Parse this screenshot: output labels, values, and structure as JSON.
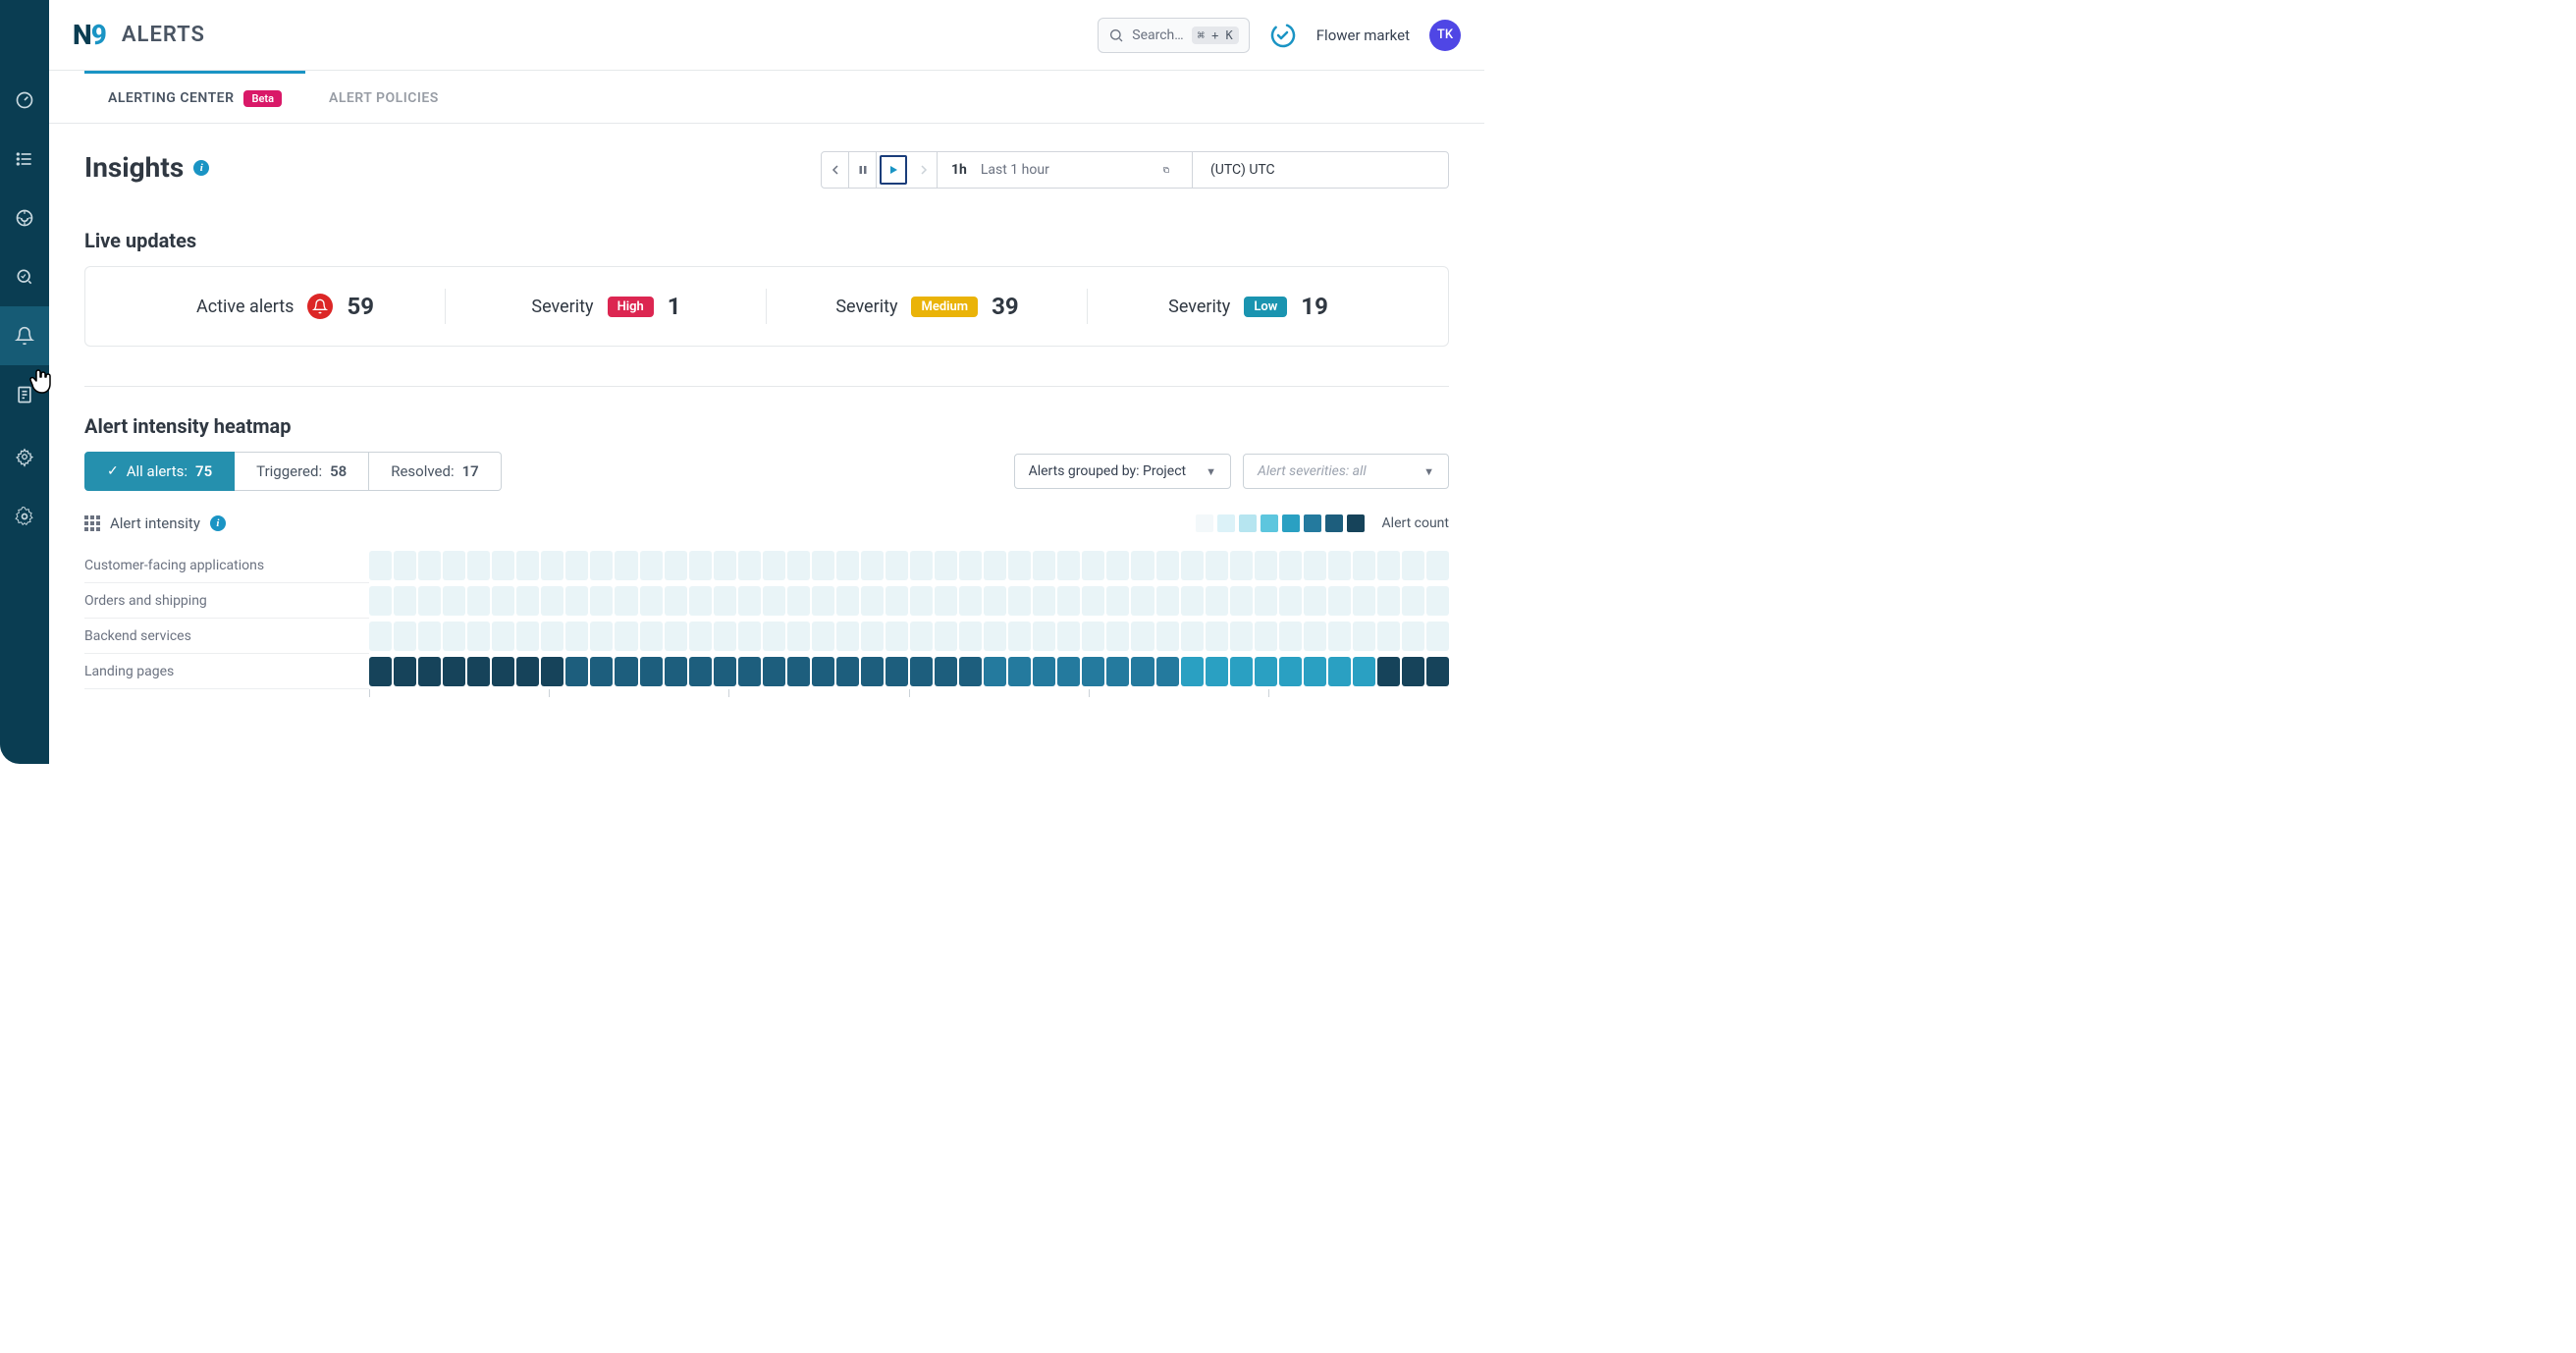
{
  "brand": {
    "n": "N",
    "nine": "9"
  },
  "page_title": "ALERTS",
  "search": {
    "placeholder": "Search…",
    "kbd": "⌘ + K"
  },
  "org": "Flower market",
  "avatar": "TK",
  "tabs": [
    {
      "label": "ALERTING CENTER",
      "badge": "Beta",
      "active": true
    },
    {
      "label": "ALERT POLICIES",
      "active": false
    }
  ],
  "insights": {
    "title": "Insights",
    "time": {
      "short": "1h",
      "long": "Last 1 hour",
      "tz": "(UTC) UTC"
    }
  },
  "live_updates": {
    "title": "Live updates",
    "active_label": "Active alerts",
    "active_value": "59",
    "sev_label": "Severity",
    "high_label": "High",
    "high_value": "1",
    "medium_label": "Medium",
    "medium_value": "39",
    "low_label": "Low",
    "low_value": "19"
  },
  "heatmap": {
    "title": "Alert intensity heatmap",
    "toggles": {
      "all_label": "All alerts:",
      "all_count": "75",
      "triggered_label": "Triggered:",
      "triggered_count": "58",
      "resolved_label": "Resolved:",
      "resolved_count": "17"
    },
    "group_by": "Alerts grouped by: Project",
    "severities": "Alert severities: all",
    "legend_left": "Alert intensity",
    "legend_right": "Alert count",
    "rows": [
      "Customer-facing applications",
      "Orders and shipping",
      "Backend services",
      "Landing pages"
    ],
    "legend_colors": [
      "#f3f8fa",
      "#dcf2f8",
      "#b6e5f0",
      "#5dc6de",
      "#2aa0c2",
      "#247a9e",
      "#1d5e7d",
      "#16435a"
    ],
    "row_colors": [
      "#e9f4f7",
      "#e9f4f7",
      "#e9f4f7",
      "mixed"
    ],
    "landing_colors": [
      "#16435a",
      "#16435a",
      "#16435a",
      "#16435a",
      "#16435a",
      "#16435a",
      "#16435a",
      "#16435a",
      "#1d5e7d",
      "#1d5e7d",
      "#1d5e7d",
      "#1d5e7d",
      "#1d5e7d",
      "#1d5e7d",
      "#1d5e7d",
      "#1d5e7d",
      "#1d5e7d",
      "#1d5e7d",
      "#1d5e7d",
      "#1d5e7d",
      "#1d5e7d",
      "#1d5e7d",
      "#1d5e7d",
      "#1d5e7d",
      "#1d5e7d",
      "#247a9e",
      "#247a9e",
      "#247a9e",
      "#247a9e",
      "#247a9e",
      "#247a9e",
      "#247a9e",
      "#247a9e",
      "#2aa0c2",
      "#2aa0c2",
      "#2aa0c2",
      "#2aa0c2",
      "#2aa0c2",
      "#2aa0c2",
      "#2aa0c2",
      "#2aa0c2",
      "#16435a",
      "#16435a",
      "#16435a"
    ]
  }
}
